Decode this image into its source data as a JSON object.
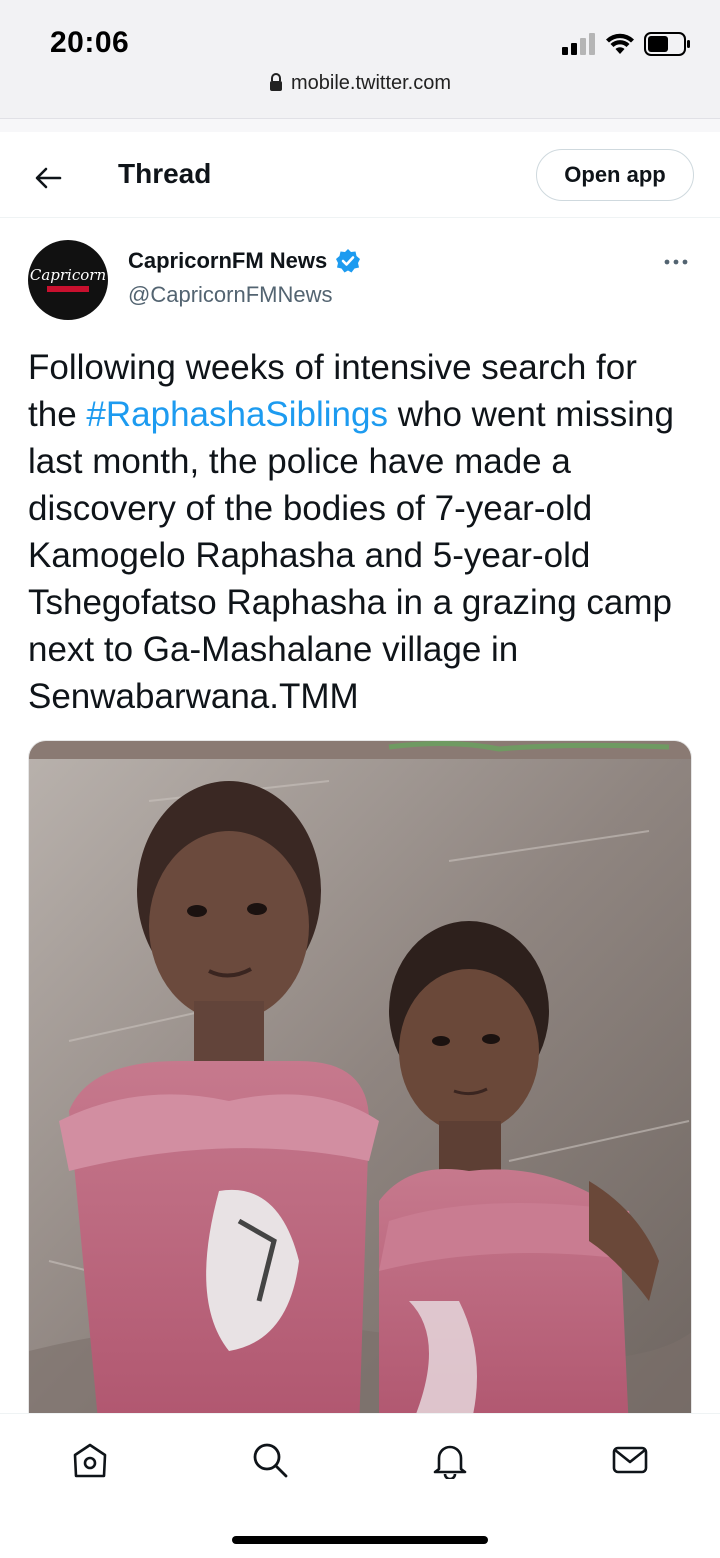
{
  "status_bar": {
    "time": "20:06"
  },
  "browser": {
    "url": "mobile.twitter.com"
  },
  "header": {
    "title": "Thread",
    "open_app_label": "Open app"
  },
  "tweet": {
    "author_name": "CapricornFM News",
    "author_handle": "@CapricornFMNews",
    "avatar_logo_text": "Capricorn",
    "text_before_hashtag": "Following weeks of intensive search for the ",
    "hashtag": "#RaphashaSiblings",
    "text_after_hashtag": " who went missing last month, the police have made a discovery of the bodies of 7-year-old Kamogelo Raphasha and 5-year-old Tshegofatso Raphasha in a grazing camp next to Ga-Mashalane village in Senwabarwana.TMM"
  },
  "colors": {
    "accent": "#1d9bf0",
    "text": "#0f1419",
    "muted": "#536471"
  },
  "icons": [
    "back-arrow-icon",
    "verified-badge-icon",
    "more-options-icon",
    "home-icon",
    "search-icon",
    "notifications-icon",
    "messages-icon",
    "lock-icon",
    "signal-icon",
    "wifi-icon",
    "battery-icon"
  ]
}
